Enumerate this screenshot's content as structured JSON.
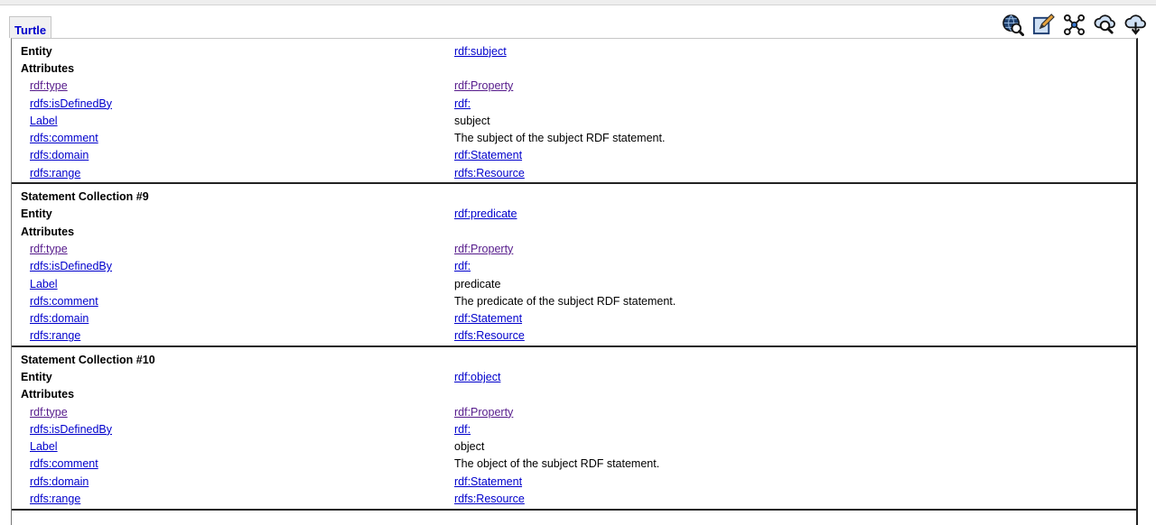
{
  "tab": {
    "label": "Turtle"
  },
  "toolbar": [
    "globe-search-icon",
    "edit-icon",
    "network-icon",
    "cloud-search-icon",
    "cloud-download-icon"
  ],
  "labels": {
    "entity": "Entity",
    "attributes": "Attributes"
  },
  "sections": [
    {
      "title": "",
      "entity": "rdf:subject",
      "attributes": [
        {
          "key": "rdf:type",
          "value": "rdf:Property",
          "key_link": true,
          "value_link": true,
          "visited": true
        },
        {
          "key": "rdfs:isDefinedBy",
          "value": "rdf:",
          "key_link": true,
          "value_link": true,
          "visited": false
        },
        {
          "key": "Label",
          "value": "subject",
          "key_link": true,
          "value_link": false,
          "visited": false
        },
        {
          "key": "rdfs:comment",
          "value": "The subject of the subject RDF statement.",
          "key_link": true,
          "value_link": false,
          "visited": false
        },
        {
          "key": "rdfs:domain",
          "value": "rdf:Statement",
          "key_link": true,
          "value_link": true,
          "visited": false
        },
        {
          "key": "rdfs:range",
          "value": "rdfs:Resource",
          "key_link": true,
          "value_link": true,
          "visited": false
        }
      ]
    },
    {
      "title": "Statement Collection #9",
      "entity": "rdf:predicate",
      "attributes": [
        {
          "key": "rdf:type",
          "value": "rdf:Property",
          "key_link": true,
          "value_link": true,
          "visited": true
        },
        {
          "key": "rdfs:isDefinedBy",
          "value": "rdf:",
          "key_link": true,
          "value_link": true,
          "visited": false
        },
        {
          "key": "Label",
          "value": "predicate",
          "key_link": true,
          "value_link": false,
          "visited": false
        },
        {
          "key": "rdfs:comment",
          "value": "The predicate of the subject RDF statement.",
          "key_link": true,
          "value_link": false,
          "visited": false
        },
        {
          "key": "rdfs:domain",
          "value": "rdf:Statement",
          "key_link": true,
          "value_link": true,
          "visited": false
        },
        {
          "key": "rdfs:range",
          "value": "rdfs:Resource",
          "key_link": true,
          "value_link": true,
          "visited": false
        }
      ]
    },
    {
      "title": "Statement Collection #10",
      "entity": "rdf:object",
      "attributes": [
        {
          "key": "rdf:type",
          "value": "rdf:Property",
          "key_link": true,
          "value_link": true,
          "visited": true
        },
        {
          "key": "rdfs:isDefinedBy",
          "value": "rdf:",
          "key_link": true,
          "value_link": true,
          "visited": false
        },
        {
          "key": "Label",
          "value": "object",
          "key_link": true,
          "value_link": false,
          "visited": false
        },
        {
          "key": "rdfs:comment",
          "value": "The object of the subject RDF statement.",
          "key_link": true,
          "value_link": false,
          "visited": false
        },
        {
          "key": "rdfs:domain",
          "value": "rdf:Statement",
          "key_link": true,
          "value_link": true,
          "visited": false
        },
        {
          "key": "rdfs:range",
          "value": "rdfs:Resource",
          "key_link": true,
          "value_link": true,
          "visited": false
        }
      ]
    }
  ]
}
